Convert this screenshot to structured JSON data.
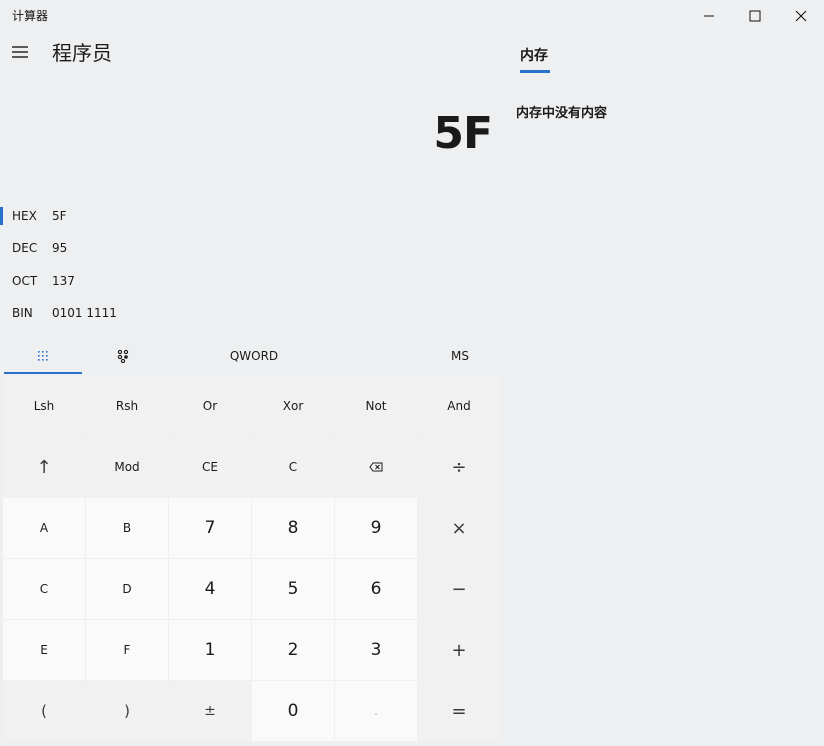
{
  "window": {
    "title": "计算器"
  },
  "header": {
    "mode": "程序员"
  },
  "display": {
    "value": "5F"
  },
  "bases": [
    {
      "label": "HEX",
      "value": "5F",
      "active": true
    },
    {
      "label": "DEC",
      "value": "95",
      "active": false
    },
    {
      "label": "OCT",
      "value": "137",
      "active": false
    },
    {
      "label": "BIN",
      "value": "0101 1111",
      "active": false
    }
  ],
  "toolbar": {
    "word_size": "QWORD",
    "memory_store": "MS"
  },
  "keypad": {
    "rows": [
      [
        "Lsh",
        "Rsh",
        "Or",
        "Xor",
        "Not",
        "And"
      ],
      [
        "↑",
        "Mod",
        "CE",
        "C",
        "⌫",
        "÷"
      ],
      [
        "A",
        "B",
        "7",
        "8",
        "9",
        "×"
      ],
      [
        "C",
        "D",
        "4",
        "5",
        "6",
        "−"
      ],
      [
        "E",
        "F",
        "1",
        "2",
        "3",
        "+"
      ],
      [
        "(",
        ")",
        "±",
        "0",
        ".",
        "="
      ]
    ]
  },
  "memory": {
    "tab_label": "内存",
    "empty_text": "内存中没有内容"
  },
  "colors": {
    "accent": "#2a6fc9",
    "background": "#eeeff0",
    "digit_key": "#fafafa",
    "function_key": "#f1f1f1"
  }
}
